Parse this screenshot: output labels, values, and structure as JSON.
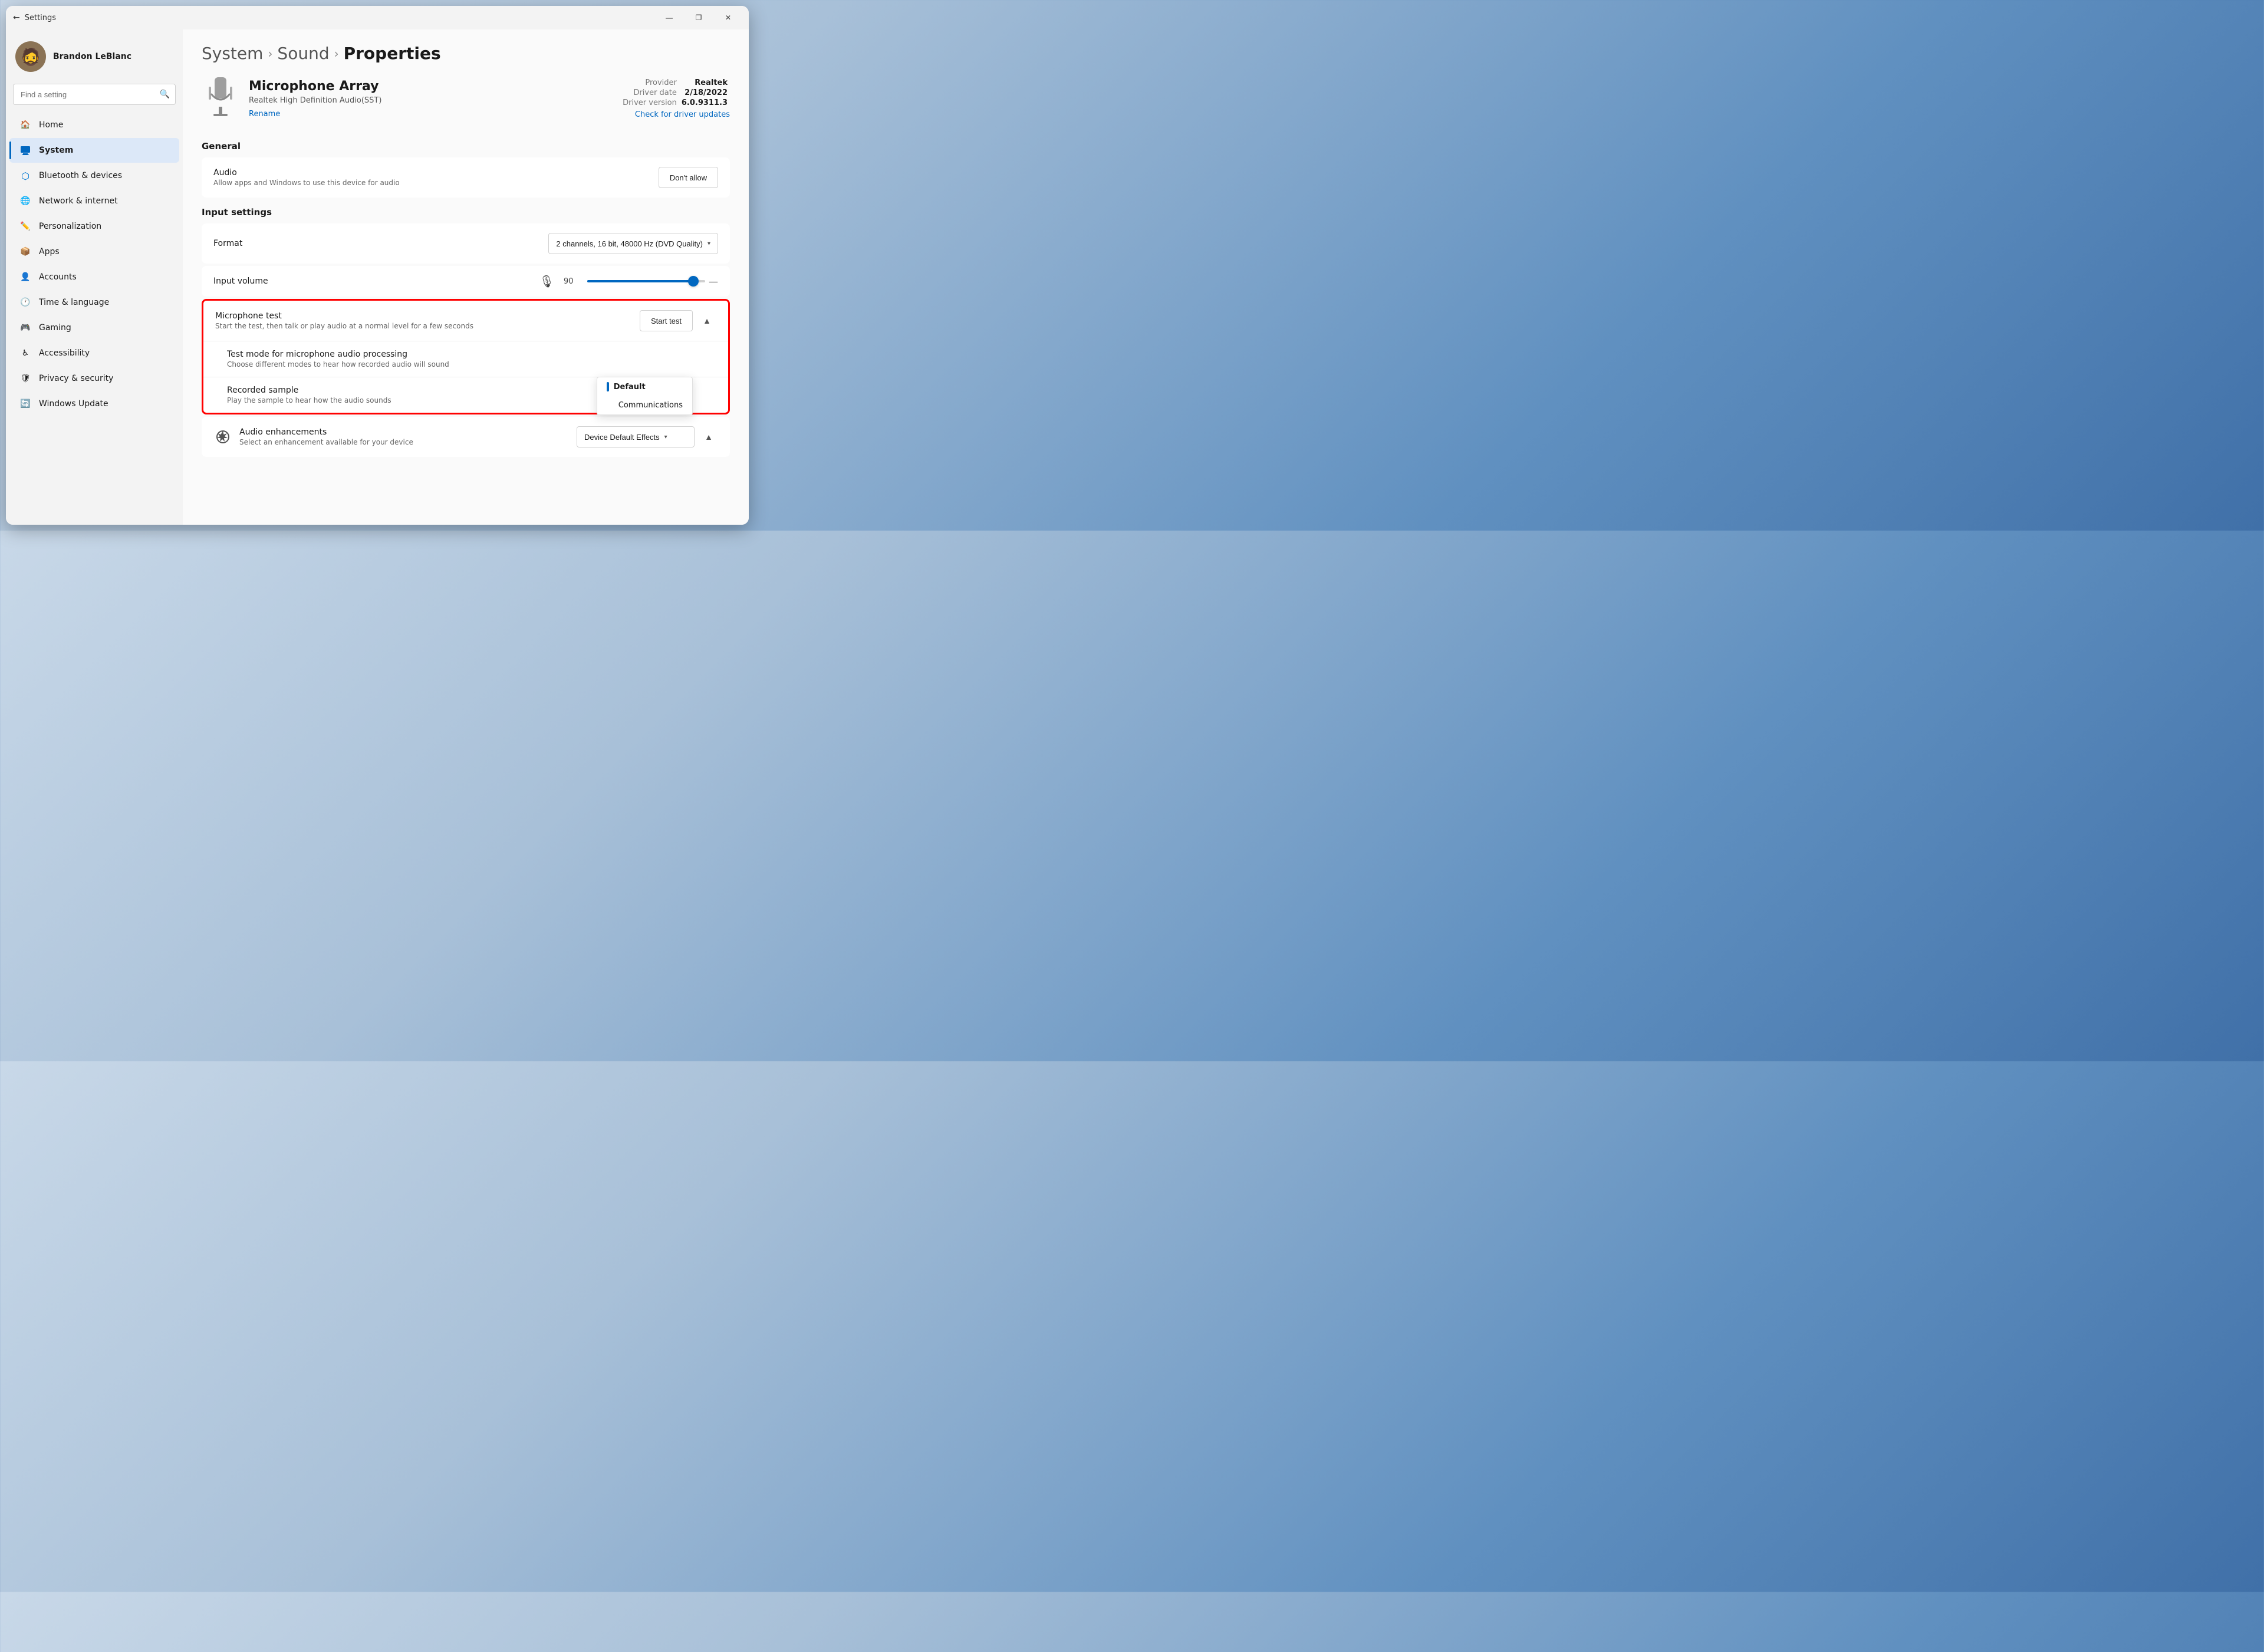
{
  "window": {
    "title": "Settings",
    "controls": {
      "minimize": "—",
      "maximize": "❐",
      "close": "✕"
    }
  },
  "sidebar": {
    "user": {
      "name": "Brandon LeBlanc",
      "avatar_emoji": "🧔"
    },
    "search": {
      "placeholder": "Find a setting",
      "icon": "🔍"
    },
    "nav_items": [
      {
        "id": "home",
        "label": "Home",
        "icon": "🏠",
        "active": false
      },
      {
        "id": "system",
        "label": "System",
        "icon": "🖥",
        "active": true
      },
      {
        "id": "bluetooth",
        "label": "Bluetooth & devices",
        "icon": "🔷",
        "active": false
      },
      {
        "id": "network",
        "label": "Network & internet",
        "icon": "🌐",
        "active": false
      },
      {
        "id": "personalization",
        "label": "Personalization",
        "icon": "✏️",
        "active": false
      },
      {
        "id": "apps",
        "label": "Apps",
        "icon": "📦",
        "active": false
      },
      {
        "id": "accounts",
        "label": "Accounts",
        "icon": "👤",
        "active": false
      },
      {
        "id": "time",
        "label": "Time & language",
        "icon": "🕐",
        "active": false
      },
      {
        "id": "gaming",
        "label": "Gaming",
        "icon": "🎮",
        "active": false
      },
      {
        "id": "accessibility",
        "label": "Accessibility",
        "icon": "♿",
        "active": false
      },
      {
        "id": "privacy",
        "label": "Privacy & security",
        "icon": "🛡",
        "active": false
      },
      {
        "id": "update",
        "label": "Windows Update",
        "icon": "🔄",
        "active": false
      }
    ]
  },
  "breadcrumb": {
    "items": [
      {
        "label": "System",
        "current": false
      },
      {
        "label": "Sound",
        "current": false
      },
      {
        "label": "Properties",
        "current": true
      }
    ]
  },
  "device": {
    "name": "Microphone Array",
    "subtitle": "Realtek High Definition Audio(SST)",
    "rename_label": "Rename",
    "meta": {
      "provider_label": "Provider",
      "provider_value": "Realtek",
      "driver_date_label": "Driver date",
      "driver_date_value": "2/18/2022",
      "driver_version_label": "Driver version",
      "driver_version_value": "6.0.9311.3",
      "check_driver_label": "Check for driver updates"
    }
  },
  "general_section": {
    "label": "General",
    "audio_row": {
      "title": "Audio",
      "desc": "Allow apps and Windows to use this device for audio",
      "button_label": "Don't allow"
    }
  },
  "input_settings_section": {
    "label": "Input settings",
    "format_row": {
      "title": "Format",
      "dropdown_value": "2 channels, 16 bit, 48000 Hz (DVD Quality)"
    },
    "volume_row": {
      "title": "Input volume",
      "value": "90",
      "percent": 90
    }
  },
  "mic_test_section": {
    "mic_test": {
      "title": "Microphone test",
      "desc": "Start the test, then talk or play audio at a normal level for a few seconds",
      "button_label": "Start test"
    },
    "test_mode": {
      "title": "Test mode for microphone audio processing",
      "desc": "Choose different modes to hear how recorded audio will sound"
    },
    "recorded_sample": {
      "title": "Recorded sample",
      "desc": "Play the sample to hear how the audio sounds"
    },
    "dropdown_options": [
      {
        "label": "Default",
        "selected": true
      },
      {
        "label": "Communications",
        "selected": false
      }
    ]
  },
  "enhancements_section": {
    "title": "Audio enhancements",
    "desc": "Select an enhancement available for your device",
    "dropdown_value": "Device Default Effects",
    "icon": "✦"
  }
}
